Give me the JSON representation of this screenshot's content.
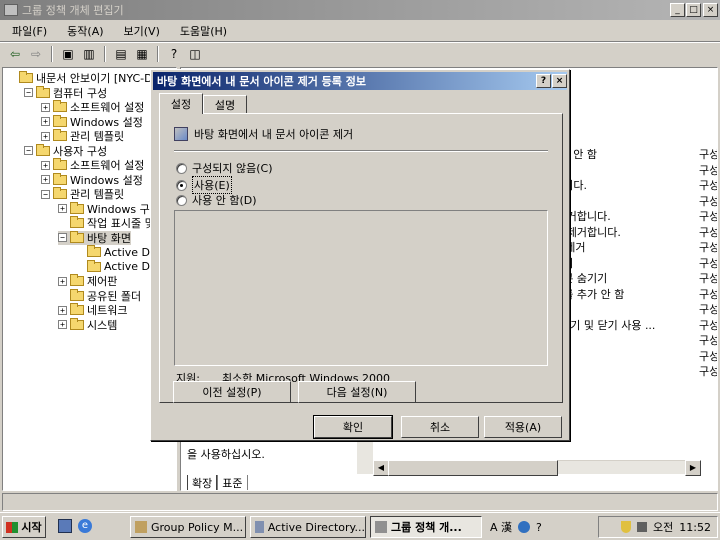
{
  "window": {
    "title": "그룹 정책 개체 편집기",
    "min": "_",
    "max": "□",
    "close": "×"
  },
  "menu": [
    "파일(F)",
    "동작(A)",
    "보기(V)",
    "도움말(H)"
  ],
  "tree": {
    "items": [
      {
        "label": "내문서 안보이기 [NYC-D",
        "pm": "",
        "indent": 0
      },
      {
        "label": "컴퓨터 구성",
        "pm": "−",
        "indent": 1
      },
      {
        "label": "소프트웨어 설정",
        "pm": "+",
        "indent": 2
      },
      {
        "label": "Windows 설정",
        "pm": "+",
        "indent": 2
      },
      {
        "label": "관리 템플릿",
        "pm": "+",
        "indent": 2
      },
      {
        "label": "사용자 구성",
        "pm": "−",
        "indent": 1
      },
      {
        "label": "소프트웨어 설정",
        "pm": "+",
        "indent": 2
      },
      {
        "label": "Windows 설정",
        "pm": "+",
        "indent": 2
      },
      {
        "label": "관리 템플릿",
        "pm": "−",
        "indent": 2
      },
      {
        "label": "Windows 구성",
        "pm": "+",
        "indent": 3
      },
      {
        "label": "작업 표시줄 및",
        "pm": "",
        "indent": 3
      },
      {
        "label": "바탕 화면",
        "pm": "−",
        "indent": 3,
        "selected": true
      },
      {
        "label": "Active Des",
        "pm": "",
        "indent": 4
      },
      {
        "label": "Active Dire",
        "pm": "",
        "indent": 4
      },
      {
        "label": "제어판",
        "pm": "+",
        "indent": 3
      },
      {
        "label": "공유된 폴더",
        "pm": "",
        "indent": 3
      },
      {
        "label": "네트워크",
        "pm": "+",
        "indent": 3
      },
      {
        "label": "시스템",
        "pm": "+",
        "indent": 3
      }
    ]
  },
  "right_pane": {
    "rows": [
      {
        "setting": "l 사용 안 함",
        "state": "구성"
      },
      {
        "setting": "",
        "state": "구성"
      },
      {
        "setting": "거합니다.",
        "state": "구성"
      },
      {
        "setting": "",
        "state": "구성"
      },
      {
        "setting": "을 제거합니다.",
        "state": "구성"
      },
      {
        "setting": "성을 제거합니다.",
        "state": "구성"
      },
      {
        "setting": "]성] 제거",
        "state": "구성"
      },
      {
        "setting": "숨기기",
        "state": "구성"
      },
      {
        "setting": "아이콘 숨기기",
        "state": "구성"
      },
      {
        "setting": "공유를 추가 안 함",
        "state": "구성"
      },
      {
        "setting": "",
        "state": "구성"
      },
      {
        "setting": "기, 놓기 및 닫기 사용 ...",
        "state": "구성"
      },
      {
        "setting": "",
        "state": "구성"
      },
      {
        "setting": "",
        "state": "구성"
      },
      {
        "setting": "",
        "state": "구성"
      }
    ],
    "desc_text": "을 사용하십시오.",
    "tabs": [
      "확장",
      "표준"
    ]
  },
  "dialog": {
    "title": "바탕 화면에서 내 문서 아이콘 제거 등록 정보",
    "help": "?",
    "close": "×",
    "tabs": [
      "설정",
      "설명"
    ],
    "policy_name": "바탕 화면에서 내 문서 아이콘 제거",
    "options": [
      {
        "label": "구성되지 않음(C)",
        "selected": false
      },
      {
        "label": "사용(E)",
        "selected": true
      },
      {
        "label": "사용 안 함(D)",
        "selected": false
      }
    ],
    "supported_label": "지원:",
    "supported_value": "최소한 Microsoft Windows 2000",
    "prev_button": "이전 설정(P)",
    "next_button": "다음 설정(N)",
    "ok_button": "확인",
    "cancel_button": "취소",
    "apply_button": "적용(A)"
  },
  "taskbar": {
    "start": "시작",
    "tasks": [
      "Group Policy M...",
      "Active Directory...",
      "그룹 정책 개..."
    ],
    "lang": "A 漢",
    "clock_label": "오전",
    "clock": "11:52"
  }
}
